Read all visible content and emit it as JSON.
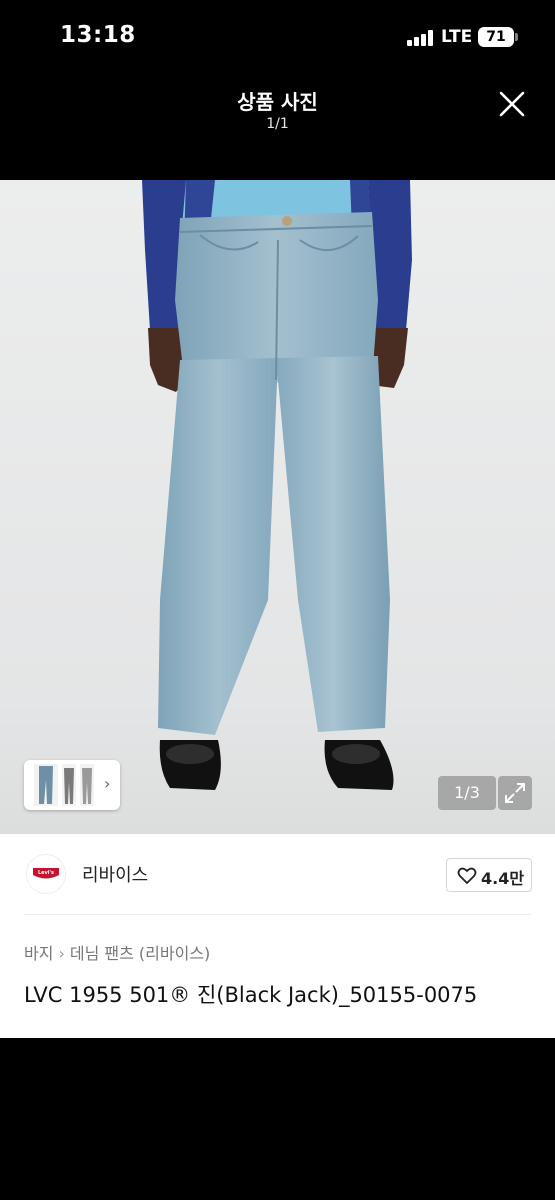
{
  "status_bar": {
    "time": "13:18",
    "network": "LTE",
    "battery": "71"
  },
  "viewer": {
    "title": "상품 사진",
    "counter": "1/1",
    "close_icon": "close-icon"
  },
  "photo": {
    "page_indicator": "1/3",
    "expand_icon": "expand-icon",
    "thumbnail_chevron": "›"
  },
  "product": {
    "brand_name": "리바이스",
    "brand_logo_text": "Levi's",
    "like_count": "4.4만",
    "breadcrumb": [
      "바지",
      "데님 팬츠 (리바이스)"
    ],
    "breadcrumb_separator": "›",
    "title": "LVC 1955 501® 진(Black Jack)_50155-0075"
  },
  "colors": {
    "background": "#000000",
    "photo_bg": "#e8e9ea",
    "denim": "#8fb0c2",
    "shirt": "#2a3d8f",
    "levis_red": "#c41230"
  }
}
